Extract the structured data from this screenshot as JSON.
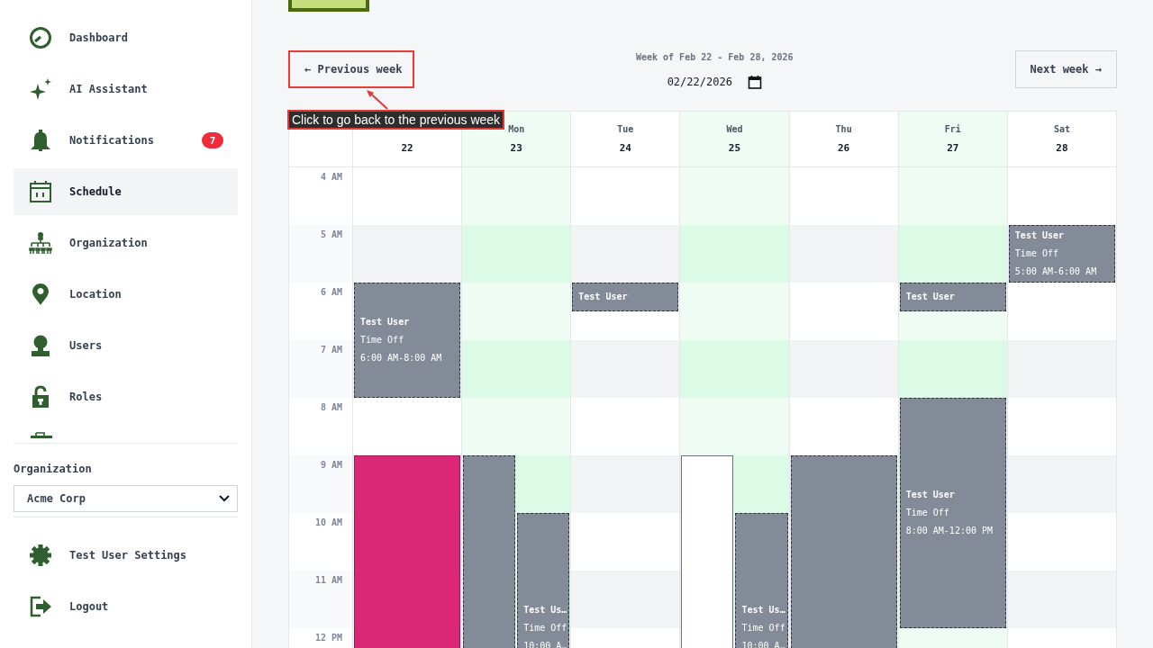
{
  "sidebar": {
    "nav": [
      {
        "label": "Dashboard",
        "selected": false
      },
      {
        "label": "AI Assistant",
        "selected": false
      },
      {
        "label": "Notifications",
        "selected": false,
        "badge": "7"
      },
      {
        "label": "Schedule",
        "selected": true
      },
      {
        "label": "Organization",
        "selected": false
      },
      {
        "label": "Location",
        "selected": false
      },
      {
        "label": "Users",
        "selected": false
      },
      {
        "label": "Roles",
        "selected": false
      }
    ],
    "organization": {
      "label": "Organization",
      "value": "Acme Corp"
    },
    "footer": [
      {
        "label": "Test User Settings"
      },
      {
        "label": "Logout"
      }
    ]
  },
  "toolbar": {
    "previous": {
      "label": "← Previous week",
      "highlighted": true
    },
    "range": "Week of Feb 22 - Feb 28, 2026",
    "date": {
      "value": "02/22/2026"
    },
    "next": {
      "label": "Next week →",
      "highlighted": false
    }
  },
  "annotation": {
    "text": "Click to go back to the previous week"
  },
  "calendar": {
    "hours": [
      "4 AM",
      "5 AM",
      "6 AM",
      "7 AM",
      "8 AM",
      "9 AM",
      "10 AM",
      "11 AM",
      "12 PM"
    ],
    "days": [
      {
        "date": "22",
        "highlighted": false,
        "lanes": [
          {
            "slots": [
              {
                "kind": "free"
              },
              {
                "kind": "free"
              },
              {
                "kind": "free"
              },
              {
                "kind": "free"
              },
              {
                "kind": "time_off",
                "title": "Test User",
                "type": "Time Off",
                "time": "6:00 AM-8:00 AM"
              },
              {
                "kind": "time_off"
              },
              {
                "kind": "time_off"
              },
              {
                "kind": "time_off"
              },
              {
                "kind": "free"
              },
              {
                "kind": "free"
              },
              {
                "kind": "shift"
              },
              {
                "kind": "shift"
              },
              {
                "kind": "shift"
              },
              {
                "kind": "shift"
              },
              {
                "kind": "shift"
              },
              {
                "kind": "shift"
              },
              {
                "kind": "shift"
              }
            ]
          }
        ]
      },
      {
        "name": "Mon",
        "date": "23",
        "highlighted": true,
        "lanes": [
          {
            "slots": [
              {
                "kind": "free"
              },
              {
                "kind": "free"
              },
              {
                "kind": "free"
              },
              {
                "kind": "free"
              },
              {
                "kind": "free"
              },
              {
                "kind": "free"
              },
              {
                "kind": "free"
              },
              {
                "kind": "free"
              },
              {
                "kind": "free"
              },
              {
                "kind": "free"
              },
              {
                "kind": "time_off"
              },
              {
                "kind": "time_off"
              },
              {
                "kind": "time_off"
              },
              {
                "kind": "time_off"
              },
              {
                "kind": "time_off"
              },
              {
                "kind": "time_off"
              },
              {
                "kind": "time_off"
              }
            ]
          },
          {
            "slots": [
              {
                "kind": "free"
              },
              {
                "kind": "free"
              },
              {
                "kind": "free"
              },
              {
                "kind": "free"
              },
              {
                "kind": "free"
              },
              {
                "kind": "free"
              },
              {
                "kind": "free"
              },
              {
                "kind": "free"
              },
              {
                "kind": "free"
              },
              {
                "kind": "free"
              },
              {
                "kind": "free"
              },
              {
                "kind": "free"
              },
              {
                "kind": "time_off",
                "title": "Test Us…",
                "type": "Time Off",
                "time": "10:00 A…"
              },
              {
                "kind": "time_off"
              },
              {
                "kind": "time_off"
              },
              {
                "kind": "time_off"
              },
              {
                "kind": "time_off"
              }
            ]
          }
        ]
      },
      {
        "name": "Tue",
        "date": "24",
        "highlighted": false,
        "lanes": [
          {
            "slots": [
              {
                "kind": "free"
              },
              {
                "kind": "free"
              },
              {
                "kind": "free"
              },
              {
                "kind": "free"
              },
              {
                "kind": "time_off",
                "title": "Test User"
              },
              {
                "kind": "free"
              },
              {
                "kind": "free"
              },
              {
                "kind": "free"
              },
              {
                "kind": "free"
              },
              {
                "kind": "free"
              },
              {
                "kind": "free"
              },
              {
                "kind": "free"
              },
              {
                "kind": "free"
              },
              {
                "kind": "free"
              },
              {
                "kind": "free"
              },
              {
                "kind": "free"
              },
              {
                "kind": "free"
              }
            ]
          }
        ]
      },
      {
        "name": "Wed",
        "date": "25",
        "highlighted": true,
        "lanes": [
          {
            "slots": [
              {
                "kind": "free"
              },
              {
                "kind": "free"
              },
              {
                "kind": "free"
              },
              {
                "kind": "free"
              },
              {
                "kind": "free"
              },
              {
                "kind": "free"
              },
              {
                "kind": "free"
              },
              {
                "kind": "free"
              },
              {
                "kind": "free"
              },
              {
                "kind": "free"
              },
              {
                "kind": "open_shift"
              },
              {
                "kind": "open_shift"
              },
              {
                "kind": "open_shift"
              },
              {
                "kind": "open_shift"
              },
              {
                "kind": "open_shift"
              },
              {
                "kind": "open_shift"
              },
              {
                "kind": "open_shift"
              }
            ]
          },
          {
            "slots": [
              {
                "kind": "free"
              },
              {
                "kind": "free"
              },
              {
                "kind": "free"
              },
              {
                "kind": "free"
              },
              {
                "kind": "free"
              },
              {
                "kind": "free"
              },
              {
                "kind": "free"
              },
              {
                "kind": "free"
              },
              {
                "kind": "free"
              },
              {
                "kind": "free"
              },
              {
                "kind": "free"
              },
              {
                "kind": "free"
              },
              {
                "kind": "time_off",
                "title": "Test Us…",
                "type": "Time Off",
                "time": "10:00 A…"
              },
              {
                "kind": "time_off"
              },
              {
                "kind": "time_off"
              },
              {
                "kind": "time_off"
              },
              {
                "kind": "time_off"
              }
            ]
          }
        ]
      },
      {
        "name": "Thu",
        "date": "26",
        "highlighted": false,
        "lanes": [
          {
            "slots": [
              {
                "kind": "free"
              },
              {
                "kind": "free"
              },
              {
                "kind": "free"
              },
              {
                "kind": "free"
              },
              {
                "kind": "free"
              },
              {
                "kind": "free"
              },
              {
                "kind": "free"
              },
              {
                "kind": "free"
              },
              {
                "kind": "free"
              },
              {
                "kind": "free"
              },
              {
                "kind": "time_off"
              },
              {
                "kind": "time_off"
              },
              {
                "kind": "time_off"
              },
              {
                "kind": "time_off"
              },
              {
                "kind": "time_off"
              },
              {
                "kind": "time_off"
              },
              {
                "kind": "time_off"
              }
            ]
          }
        ]
      },
      {
        "name": "Fri",
        "date": "27",
        "highlighted": true,
        "lanes": [
          {
            "slots": [
              {
                "kind": "free"
              },
              {
                "kind": "free"
              },
              {
                "kind": "free"
              },
              {
                "kind": "free"
              },
              {
                "kind": "time_off",
                "title": "Test User"
              },
              {
                "kind": "free"
              },
              {
                "kind": "free"
              },
              {
                "kind": "free"
              },
              {
                "kind": "time_off",
                "title": "Test User",
                "type": "Time Off",
                "time": "8:00 AM-12:00 PM"
              },
              {
                "kind": "time_off"
              },
              {
                "kind": "time_off"
              },
              {
                "kind": "time_off"
              },
              {
                "kind": "time_off"
              },
              {
                "kind": "time_off"
              },
              {
                "kind": "time_off"
              },
              {
                "kind": "time_off"
              },
              {
                "kind": "free"
              }
            ]
          }
        ]
      },
      {
        "name": "Sat",
        "date": "28",
        "highlighted": false,
        "lanes": [
          {
            "slots": [
              {
                "kind": "free"
              },
              {
                "kind": "free"
              },
              {
                "kind": "time_off",
                "title": "Test User",
                "type": "Time Off",
                "time": "5:00 AM-6:00 AM"
              },
              {
                "kind": "time_off"
              },
              {
                "kind": "free"
              },
              {
                "kind": "free"
              },
              {
                "kind": "free"
              },
              {
                "kind": "free"
              },
              {
                "kind": "free"
              },
              {
                "kind": "free"
              },
              {
                "kind": "free"
              },
              {
                "kind": "free"
              },
              {
                "kind": "free"
              },
              {
                "kind": "free"
              },
              {
                "kind": "free"
              },
              {
                "kind": "free"
              },
              {
                "kind": "free"
              }
            ]
          }
        ]
      }
    ]
  }
}
